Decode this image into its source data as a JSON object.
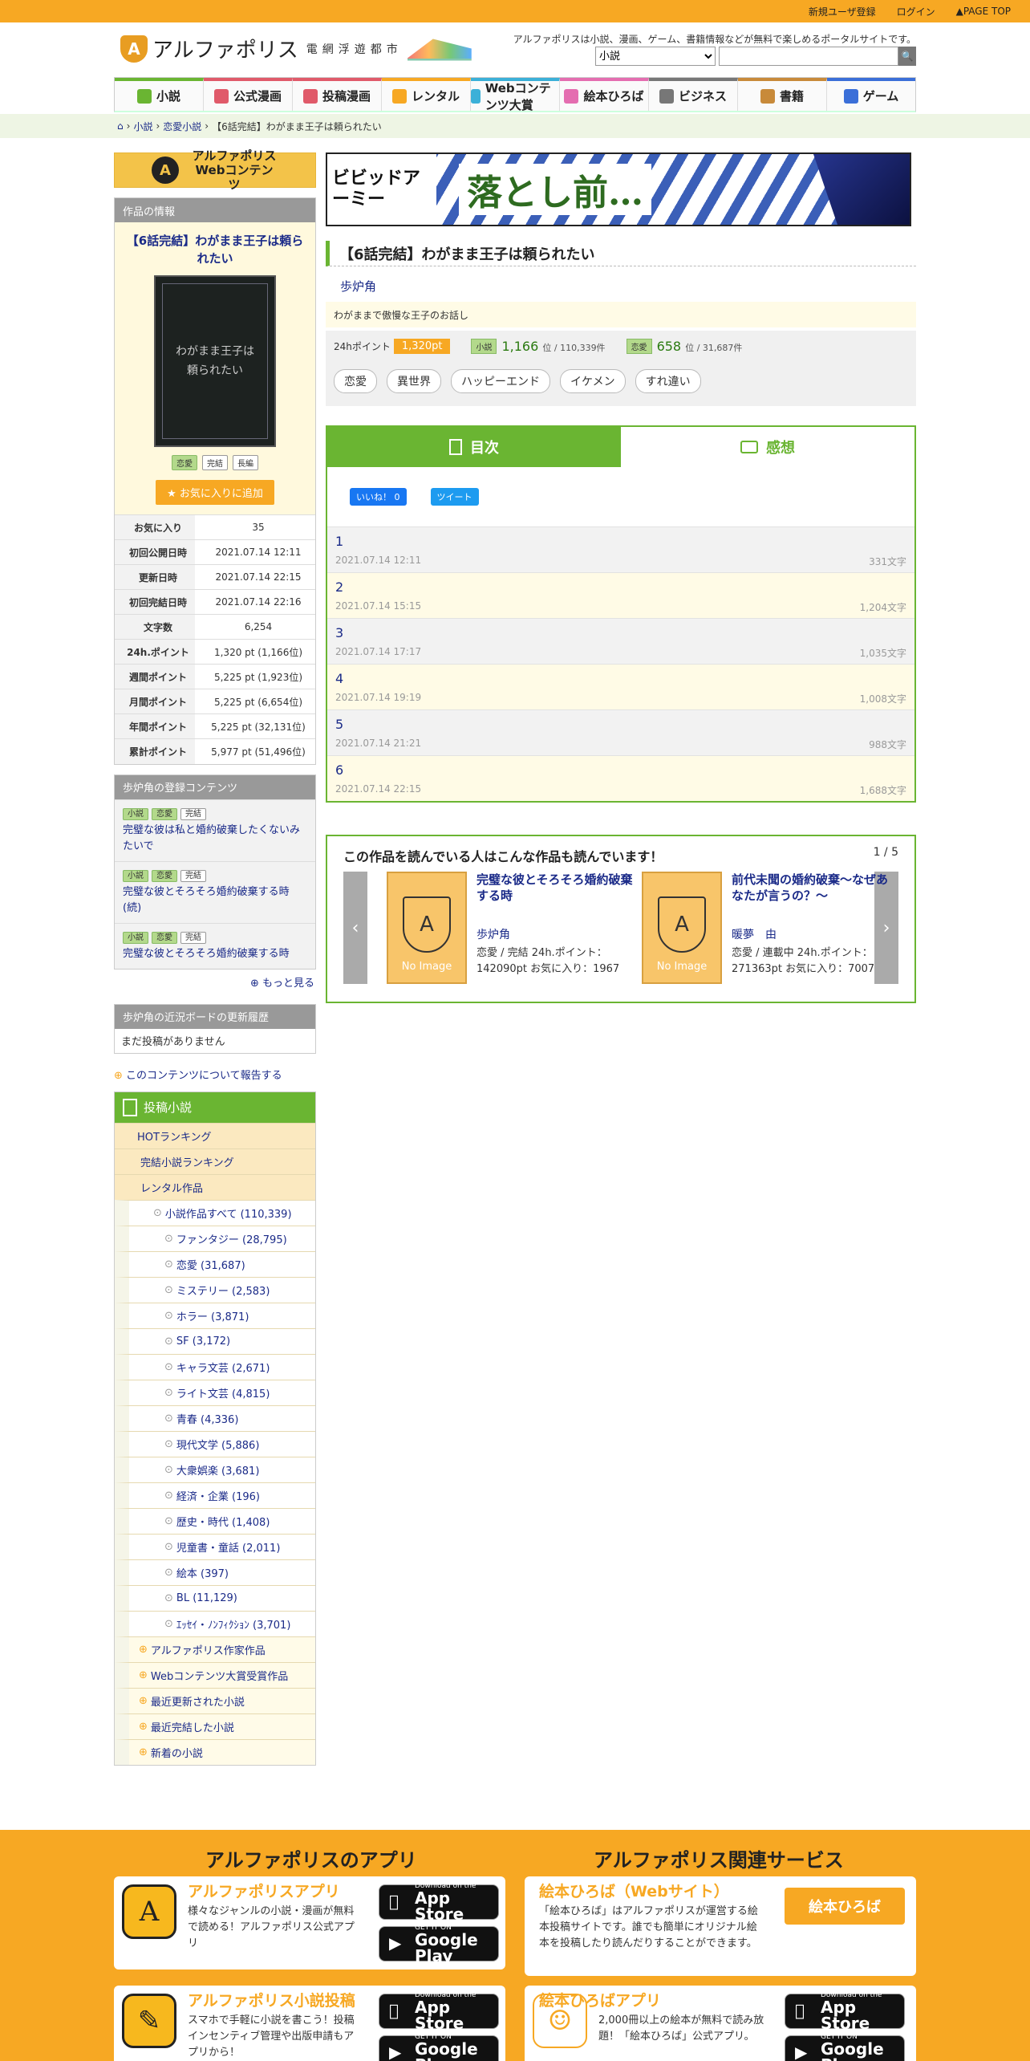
{
  "topbar": {
    "register": "新規ユーザ登録",
    "login": "ログイン",
    "pagetop": "▲PAGE TOP"
  },
  "header": {
    "logo_text": "アルファポリス",
    "logo_sub": "電網浮遊都市",
    "tagline": "アルファポリスは小説、漫画、ゲーム、書籍情報などが無料で楽しめるポータルサイトです。",
    "search_select": "小説",
    "search_placeholder": ""
  },
  "nav": [
    {
      "label": "小説",
      "color": "#6ab532"
    },
    {
      "label": "公式漫画",
      "color": "#e05a6a"
    },
    {
      "label": "投稿漫画",
      "color": "#e05a6a"
    },
    {
      "label": "レンタル",
      "color": "#f7a823"
    },
    {
      "label": "Webコンテンツ大賞",
      "color": "#3bb0d8"
    },
    {
      "label": "絵本ひろば",
      "color": "#e46db0"
    },
    {
      "label": "ビジネス",
      "color": "#777"
    },
    {
      "label": "書籍",
      "color": "#c88a3a"
    },
    {
      "label": "ゲーム",
      "color": "#3b6fd8"
    }
  ],
  "breadcrumb": {
    "home": "⌂",
    "c1": "小説",
    "c2": "恋愛小説",
    "current": "【6話完結】わがまま王子は頼られたい"
  },
  "side": {
    "webcontents": "アルファポリス Webコンテンツ",
    "info_header": "作品の情報",
    "title": "【6話完結】わがまま王子は頼られたい",
    "cover_text": "わがまま王子は頼られたい",
    "tags": [
      "恋愛",
      "完結",
      "長編"
    ],
    "fav": "★ お気に入りに追加",
    "stats": [
      {
        "k": "お気に入り",
        "v": "35"
      },
      {
        "k": "初回公開日時",
        "v": "2021.07.14 12:11"
      },
      {
        "k": "更新日時",
        "v": "2021.07.14 22:15"
      },
      {
        "k": "初回完結日時",
        "v": "2021.07.14 22:16"
      },
      {
        "k": "文字数",
        "v": "6,254"
      },
      {
        "k": "24h.ポイント",
        "v": "1,320 pt (1,166位)"
      },
      {
        "k": "週間ポイント",
        "v": "5,225 pt (1,923位)"
      },
      {
        "k": "月間ポイント",
        "v": "5,225 pt (6,654位)"
      },
      {
        "k": "年間ポイント",
        "v": "5,225 pt (32,131位)"
      },
      {
        "k": "累計ポイント",
        "v": "5,977 pt (51,496位)"
      }
    ],
    "rel_header": "歩炉角の登録コンテンツ",
    "rel": [
      {
        "tags": [
          "小説",
          "恋愛",
          "完結"
        ],
        "title": "完璧な彼は私と婚約破棄したくないみたいで"
      },
      {
        "tags": [
          "小説",
          "恋愛",
          "完結"
        ],
        "title": "完璧な彼とそろそろ婚約破棄する時(続)"
      },
      {
        "tags": [
          "小説",
          "恋愛",
          "完結"
        ],
        "title": "完璧な彼とそろそろ婚約破棄する時"
      }
    ],
    "more": "もっと見る",
    "board_header": "歩炉角の近況ボードの更新履歴",
    "board_empty": "まだ投稿がありません",
    "report": "このコンテンツについて報告する",
    "cat_header": "投稿小説",
    "cats_top": [
      "HOTランキング",
      "完結小説ランキング",
      "レンタル作品"
    ],
    "cat_all": "小説作品すべて (110,339)",
    "cats_sub": [
      "ファンタジー (28,795)",
      "恋愛 (31,687)",
      "ミステリー (2,583)",
      "ホラー (3,871)",
      "SF (3,172)",
      "キャラ文芸 (2,671)",
      "ライト文芸 (4,815)",
      "青春 (4,336)",
      "現代文学 (5,886)",
      "大衆娯楽 (3,681)",
      "経済・企業 (196)",
      "歴史・時代 (1,408)",
      "児童書・童話 (2,011)",
      "絵本 (397)",
      "BL (11,129)",
      "ｴｯｾｲ・ﾉﾝﾌｨｸｼｮﾝ (3,701)"
    ],
    "cats_bottom": [
      "アルファポリス作家作品",
      "Webコンテンツ大賞受賞作品",
      "最近更新された小説",
      "最近完結した小説",
      "新着の小説"
    ]
  },
  "banner": {
    "left": "ビビッドアーミー",
    "text": "落とし前…"
  },
  "work": {
    "title": "【6話完結】わがまま王子は頼られたい",
    "author": "歩炉角",
    "desc": "わがままで傲慢な王子のお話し",
    "pt_label": "24hポイント",
    "pt_value": "1,320pt",
    "rank1_label": "小説",
    "rank1": "1,166",
    "rank1_total": "位 / 110,339件",
    "rank2_label": "恋愛",
    "rank2": "658",
    "rank2_total": "位 / 31,687件",
    "tags": [
      "恋愛",
      "異世界",
      "ハッピーエンド",
      "イケメン",
      "すれ違い"
    ]
  },
  "toc": {
    "tab1": "目次",
    "tab2": "感想",
    "fb": "いいね！ 0",
    "tw": "ツイート",
    "episodes": [
      {
        "n": "1",
        "d": "2021.07.14 12:11",
        "c": "331文字"
      },
      {
        "n": "2",
        "d": "2021.07.14 15:15",
        "c": "1,204文字"
      },
      {
        "n": "3",
        "d": "2021.07.14 17:17",
        "c": "1,035文字"
      },
      {
        "n": "4",
        "d": "2021.07.14 19:19",
        "c": "1,008文字"
      },
      {
        "n": "5",
        "d": "2021.07.14 21:21",
        "c": "988文字"
      },
      {
        "n": "6",
        "d": "2021.07.14 22:15",
        "c": "1,688文字"
      }
    ]
  },
  "reco": {
    "title": "この作品を読んでいる人はこんな作品も読んでいます！",
    "page": "1 / 5",
    "noimage": "No Image",
    "items": [
      {
        "title": "完璧な彼とそろそろ婚約破棄する時",
        "author": "歩炉角",
        "meta": "恋愛 / 完結 24h.ポイント：142090pt お気に入り：1967"
      },
      {
        "title": "前代未聞の婚約破棄～なぜあなたが言うの？～",
        "author": "暖夢　由",
        "meta": "恋愛 / 連載中 24h.ポイント：271363pt お気に入り：7007"
      }
    ]
  },
  "footer": {
    "apps_title": "アルファポリスのアプリ",
    "services_title": "アルファポリス関連サービス",
    "app1_name": "アルファポリスアプリ",
    "app1_desc": "様々なジャンルの小説・漫画が無料で読める！アルファポリス公式アプリ",
    "app2_name": "アルファポリス小説投稿",
    "app2_desc": "スマホで手軽に小説を書こう！投稿インセンティブ管理や出版申請もアプリから！",
    "appstore": "App Store",
    "appstore_small": "Download on the",
    "googleplay": "Google Play",
    "googleplay_small": "GET IT ON",
    "svc1_name": "絵本ひろば（Webサイト）",
    "svc1_desc": "「絵本ひろば」はアルファポリスが運営する絵本投稿サイトです。誰でも簡単にオリジナル絵本を投稿したり読んだりすることができます。",
    "svc1_btn": "絵本ひろば",
    "svc2_name": "絵本ひろばアプリ",
    "svc2_desc": "2,000冊以上の絵本が無料で読み放題！「絵本ひろば」公式アプリ。"
  }
}
